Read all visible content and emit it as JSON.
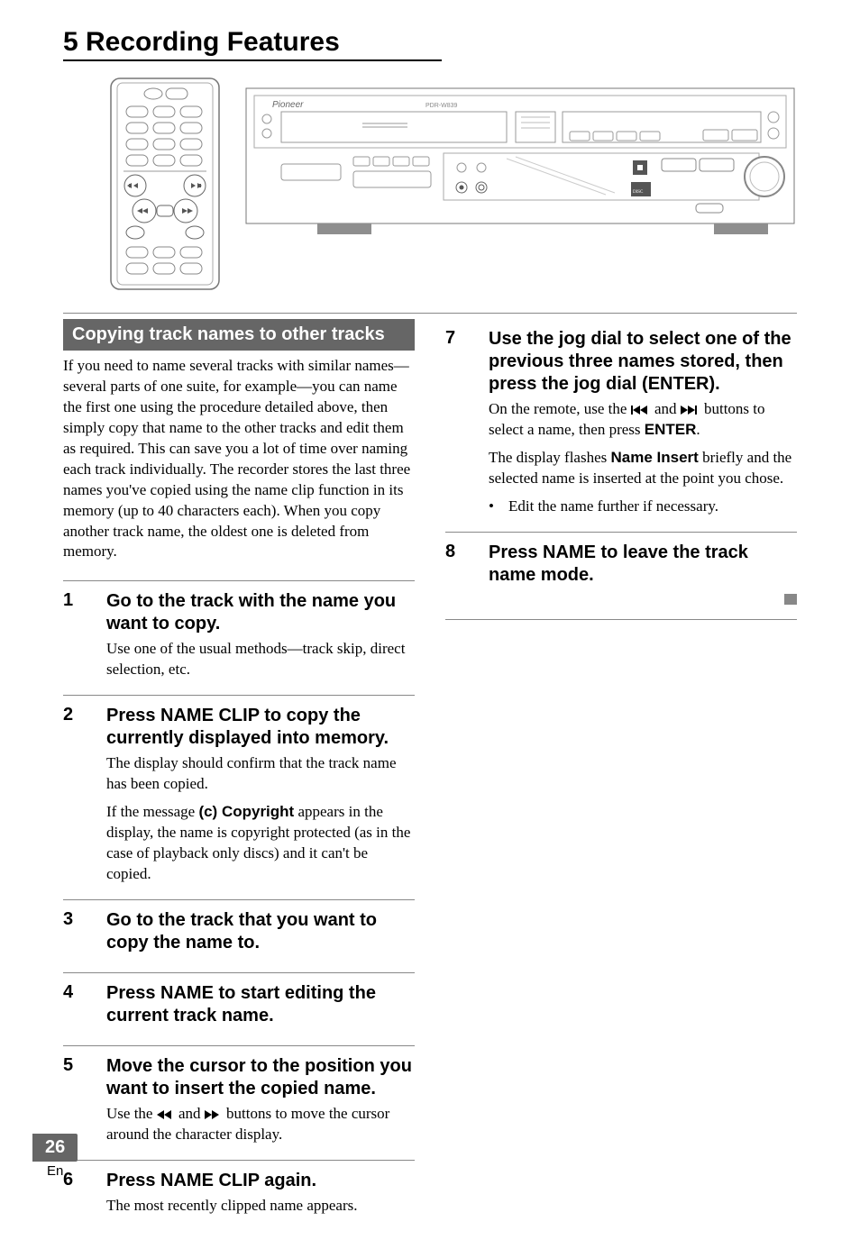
{
  "chapter": "5 Recording Features",
  "section_bar": "Copying track names to other tracks",
  "intro": "If you need to name several tracks with similar names—several parts of one suite, for example—you can name the first one using the procedure detailed above, then simply copy that name to the other tracks and edit them as required. This can save you a lot of time over naming each track individually. The recorder stores the last three names you've copied using the name clip function in its memory (up to 40 characters each). When you copy another track name, the oldest one is deleted from memory.",
  "steps_left": [
    {
      "num": "1",
      "title": "Go to the track with the name you want to copy.",
      "paras": [
        {
          "text": "Use one of the usual methods—track skip, direct selection, etc."
        }
      ]
    },
    {
      "num": "2",
      "title": "Press NAME CLIP to copy the currently displayed into memory.",
      "paras": [
        {
          "text": "The display should confirm that the track name has been copied."
        },
        {
          "pre": "If the message ",
          "bold": "(c) Copyright",
          "post": " appears in the display, the name is copyright protected (as in the case of playback only discs) and it can't be copied."
        }
      ]
    },
    {
      "num": "3",
      "title": "Go to the track that you want to copy the name to.",
      "paras": []
    },
    {
      "num": "4",
      "title": "Press NAME to start editing the current track name.",
      "paras": []
    },
    {
      "num": "5",
      "title": "Move the cursor to the position you want to insert the copied name.",
      "paras": [
        {
          "icons5": true,
          "pre": "Use the ",
          "mid": " and ",
          "post": " buttons to move the cursor around the character display."
        }
      ]
    },
    {
      "num": "6",
      "title": "Press NAME CLIP again.",
      "paras": [
        {
          "text": "The most recently clipped name appears."
        }
      ]
    }
  ],
  "steps_right": [
    {
      "num": "7",
      "title": "Use the jog dial to select one of the previous three names stored, then press the jog dial (ENTER).",
      "paras": [
        {
          "icons7": true,
          "pre": "On the remote, use the ",
          "mid": " and ",
          "post": " buttons to select a name, then press ",
          "bold_tail": "ENTER",
          "tail": "."
        },
        {
          "pre": "The display flashes ",
          "bold": "Name Insert",
          "post": " briefly and the selected name is inserted at the point you chose."
        }
      ],
      "bullet": "Edit the name further if necessary."
    },
    {
      "num": "8",
      "title": "Press NAME to leave the track name mode.",
      "paras": []
    }
  ],
  "footer": {
    "page": "26",
    "lang": "En"
  },
  "icons": {
    "rew": "rewind-icon",
    "ffwd": "fast-forward-icon",
    "prev": "prev-track-icon",
    "next": "next-track-icon"
  }
}
